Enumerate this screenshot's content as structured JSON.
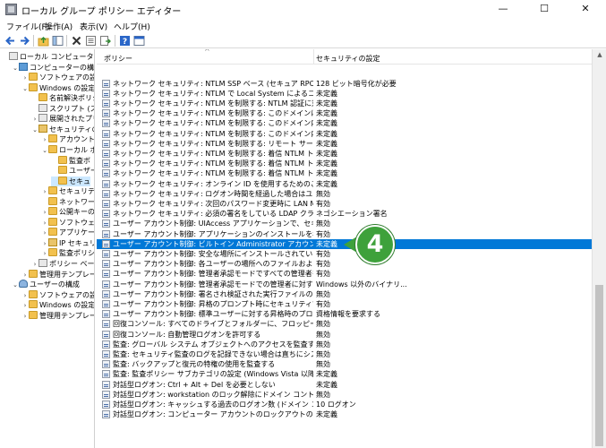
{
  "window": {
    "title": "ローカル グループ ポリシー エディター",
    "minimize": "—",
    "maximize": "☐",
    "close": "✕"
  },
  "menu": [
    "ファイル(F)",
    "操作(A)",
    "表示(V)",
    "ヘルプ(H)"
  ],
  "toolbar": [
    "back-icon",
    "forward-icon",
    "up-folder-icon",
    "show-hide-tree-icon",
    "delete-icon",
    "properties-icon",
    "export-list-icon",
    "help-icon",
    "console-icon"
  ],
  "tree": [
    {
      "label": "ローカル コンピューター ポリシ",
      "indent": 0,
      "exp": "",
      "icon": "doc"
    },
    {
      "label": "コンピューターの構成",
      "indent": 1,
      "exp": "⌄",
      "icon": "comp"
    },
    {
      "label": "ソフトウェアの設定",
      "indent": 2,
      "exp": "›",
      "icon": "fold"
    },
    {
      "label": "Windows の設定",
      "indent": 2,
      "exp": "⌄",
      "icon": "fold"
    },
    {
      "label": "名前解決ポリシ",
      "indent": 3,
      "exp": "",
      "icon": "fold"
    },
    {
      "label": "スクリプト (スタ",
      "indent": 3,
      "exp": "",
      "icon": "doc"
    },
    {
      "label": "展開されたプリ",
      "indent": 3,
      "exp": "›",
      "icon": "doc"
    },
    {
      "label": "セキュリティの設",
      "indent": 3,
      "exp": "⌄",
      "icon": "sec"
    },
    {
      "label": "アカウント ボ",
      "indent": 4,
      "exp": "›",
      "icon": "fold"
    },
    {
      "label": "ローカル ポ",
      "indent": 4,
      "exp": "⌄",
      "icon": "fold"
    },
    {
      "label": "監査ボ",
      "indent": 5,
      "exp": "",
      "icon": "fold"
    },
    {
      "label": "ユーザー",
      "indent": 5,
      "exp": "",
      "icon": "fold"
    },
    {
      "label": "セキュ",
      "indent": 5,
      "exp": "",
      "icon": "fold",
      "selected": true
    },
    {
      "label": "セキュリティ",
      "indent": 4,
      "exp": "›",
      "icon": "fold"
    },
    {
      "label": "ネットワーク",
      "indent": 4,
      "exp": "",
      "icon": "fold"
    },
    {
      "label": "公開キーの",
      "indent": 4,
      "exp": "›",
      "icon": "fold"
    },
    {
      "label": "ソフトウェア",
      "indent": 4,
      "exp": "›",
      "icon": "fold"
    },
    {
      "label": "アプリケーシ",
      "indent": 4,
      "exp": "›",
      "icon": "fold"
    },
    {
      "label": "IP セキュリ",
      "indent": 4,
      "exp": "›",
      "icon": "sec"
    },
    {
      "label": "監査ポリシ",
      "indent": 4,
      "exp": "›",
      "icon": "fold"
    },
    {
      "label": "ポリシー ベースの",
      "indent": 3,
      "exp": "›",
      "icon": "doc"
    },
    {
      "label": "管理用テンプレート",
      "indent": 2,
      "exp": "›",
      "icon": "fold"
    },
    {
      "label": "ユーザーの構成",
      "indent": 1,
      "exp": "⌄",
      "icon": "user"
    },
    {
      "label": "ソフトウェアの設定",
      "indent": 2,
      "exp": "›",
      "icon": "fold"
    },
    {
      "label": "Windows の設定",
      "indent": 2,
      "exp": "›",
      "icon": "fold"
    },
    {
      "label": "管理用テンプレート",
      "indent": 2,
      "exp": "›",
      "icon": "fold"
    }
  ],
  "list": {
    "columns": {
      "policy": "ポリシー",
      "setting": "セキュリティの設定"
    },
    "sort_indicator": "^",
    "rows": [
      {
        "policy": "ネットワーク セキュリティ: NTLM SSP ベース (セキュア RPC を含む) の...",
        "setting": "128 ビット暗号化が必要"
      },
      {
        "policy": "ネットワーク セキュリティ: NTLM で Local System によるコンピューター...",
        "setting": "未定義"
      },
      {
        "policy": "ネットワーク セキュリティ: NTLM を制限する: NTLM 認証に対するリ...",
        "setting": "未定義"
      },
      {
        "policy": "ネットワーク セキュリティ: NTLM を制限する: このドメインにサーバーの...",
        "setting": "未定義"
      },
      {
        "policy": "ネットワーク セキュリティ: NTLM を制限する: このドメイン内の NTLM ...",
        "setting": "未定義"
      },
      {
        "policy": "ネットワーク セキュリティ: NTLM を制限する: このドメイン内の NTLM ...",
        "setting": "未定義"
      },
      {
        "policy": "ネットワーク セキュリティ: NTLM を制限する: リモート サーバーに対す...",
        "setting": "未定義"
      },
      {
        "policy": "ネットワーク セキュリティ: NTLM を制限する: 着信 NTLM トラフィック",
        "setting": "未定義"
      },
      {
        "policy": "ネットワーク セキュリティ: NTLM を制限する: 着信 NTLM トラフィッ...",
        "setting": "未定義"
      },
      {
        "policy": "ネットワーク セキュリティ: NTLM を制限する: 着信 NTLM トラフィッ...",
        "setting": "未定義"
      },
      {
        "policy": "ネットワーク セキュリティ: オンライン ID を使用するためのこのコンピュ...",
        "setting": "未定義"
      },
      {
        "policy": "ネットワーク セキュリティ: ログオン時間を経過した場合はユーザーを強...",
        "setting": "無効"
      },
      {
        "policy": "ネットワーク セキュリティ: 次回のパスワード変更時に LAN Manager...",
        "setting": "有効"
      },
      {
        "policy": "ネットワーク セキュリティ: 必須の署名をしている LDAP クライアント",
        "setting": "ネゴシエーション署名"
      },
      {
        "policy": "ユーザー アカウント制御: UIAccess アプリケーションで、セキュリティで...",
        "setting": "無効"
      },
      {
        "policy": "ユーザー アカウント制御: アプリケーションのインストールを検出し、昇...",
        "setting": "有効"
      },
      {
        "policy": "ユーザー アカウント制御: ビルトイン Administrator アカウントのための...",
        "setting": "未定義",
        "selected": true
      },
      {
        "policy": "ユーザー アカウント制御: 安全な場所にインストールされている UIAcc...",
        "setting": "有効"
      },
      {
        "policy": "ユーザー アカウント制御: 各ユーザーの場所へのファイルおよびレジスト...",
        "setting": "有効"
      },
      {
        "policy": "ユーザー アカウント制御: 管理者承認モードですべての管理者を実行...",
        "setting": "有効"
      },
      {
        "policy": "ユーザー アカウント制御: 管理者承認モードでの管理者に対する昇...",
        "setting": "Windows 以外のバイナリ..."
      },
      {
        "policy": "ユーザー アカウント制御: 署名され検証された実行ファイルのみを昇...",
        "setting": "無効"
      },
      {
        "policy": "ユーザー アカウント制御: 昇格のプロンプト時にセキュリティで保護され...",
        "setting": "有効"
      },
      {
        "policy": "ユーザー アカウント制御: 標準ユーザーに対する昇格時のプロンプトの...",
        "setting": "資格情報を要求する"
      },
      {
        "policy": "回復コンソール: すべてのドライブとフォルダーに、フロッピーのコピーとア...",
        "setting": "無効"
      },
      {
        "policy": "回復コンソール: 自動管理ログオンを許可する",
        "setting": "無効"
      },
      {
        "policy": "監査: グローバル システム オブジェクトへのアクセスを監査する",
        "setting": "無効"
      },
      {
        "policy": "監査: セキュリティ監査のログを記録できない場合は直ちにシステムを...",
        "setting": "無効"
      },
      {
        "policy": "監査: バックアップと復元の特権の使用を監査する",
        "setting": "無効"
      },
      {
        "policy": "監査: 監査ポリシー サブカテゴリの設定 (Windows Vista 以降) を...",
        "setting": "未定義"
      },
      {
        "policy": "対話型ログオン: Ctrl + Alt + Del を必要としない",
        "setting": "未定義"
      },
      {
        "policy": "対話型ログオン: workstation のロック解除にドメイン コントローラーの...",
        "setting": "無効"
      },
      {
        "policy": "対話型ログオン: キャッシュする過去のログオン数 (ドメイン コントローラー...",
        "setting": "10 ログオン"
      },
      {
        "policy": "対話型ログオン: コンピューター アカウントのロックアウトのしきい値",
        "setting": "未定義"
      }
    ]
  },
  "callout": {
    "number": "4",
    "color": "#3ea13b"
  },
  "colors": {
    "selection": "#0078d7",
    "accent": "#3ea13b"
  }
}
